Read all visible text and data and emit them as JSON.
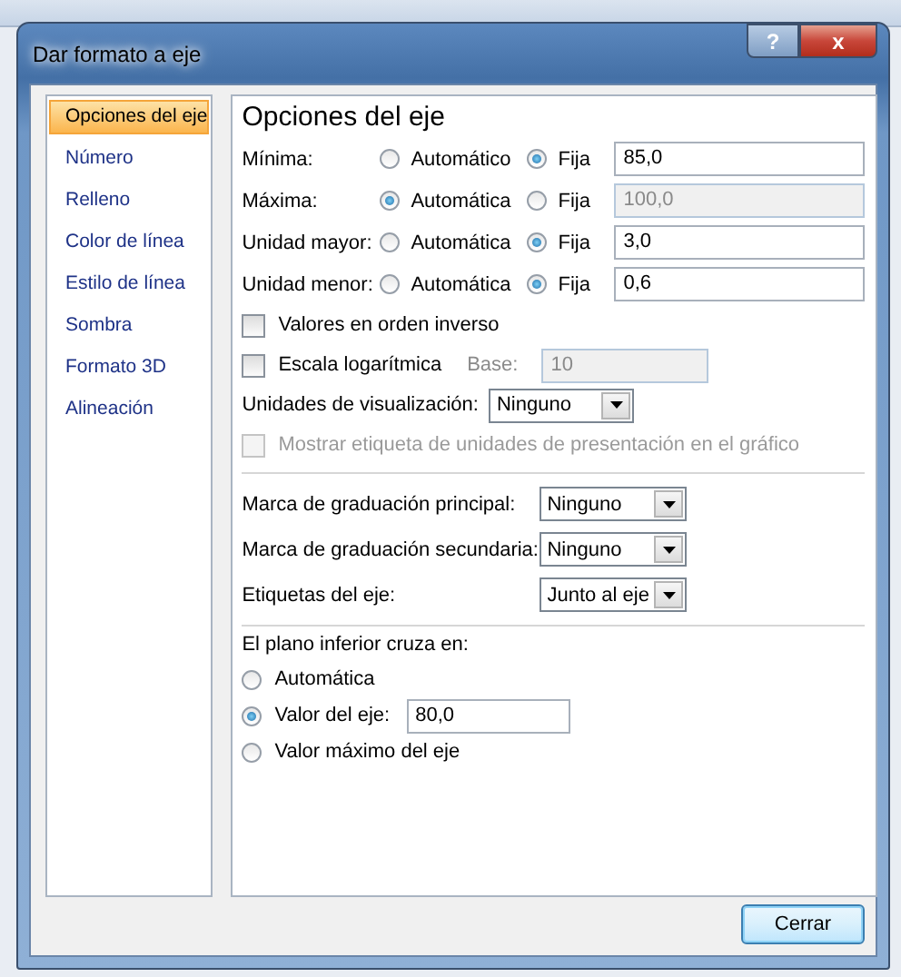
{
  "window": {
    "title": "Dar formato a eje",
    "help_button": "?",
    "close_button": "x"
  },
  "sidebar": {
    "items": [
      {
        "label": "Opciones del eje",
        "selected": true
      },
      {
        "label": "Número",
        "selected": false
      },
      {
        "label": "Relleno",
        "selected": false
      },
      {
        "label": "Color de línea",
        "selected": false
      },
      {
        "label": "Estilo de línea",
        "selected": false
      },
      {
        "label": "Sombra",
        "selected": false
      },
      {
        "label": "Formato 3D",
        "selected": false
      },
      {
        "label": "Alineación",
        "selected": false
      }
    ]
  },
  "panel": {
    "title": "Opciones del eje",
    "bounds": [
      {
        "label": "Mínima:",
        "options": [
          {
            "label": "Automático",
            "selected": false
          },
          {
            "label": "Fija",
            "selected": true
          }
        ],
        "value": "85,0",
        "disabled": false
      },
      {
        "label": "Máxima:",
        "options": [
          {
            "label": "Automática",
            "selected": true
          },
          {
            "label": "Fija",
            "selected": false
          }
        ],
        "value": "100,0",
        "disabled": true
      },
      {
        "label": "Unidad mayor:",
        "options": [
          {
            "label": "Automática",
            "selected": false
          },
          {
            "label": "Fija",
            "selected": true
          }
        ],
        "value": "3,0",
        "disabled": false
      },
      {
        "label": "Unidad menor:",
        "options": [
          {
            "label": "Automática",
            "selected": false
          },
          {
            "label": "Fija",
            "selected": true
          }
        ],
        "value": "0,6",
        "disabled": false
      }
    ],
    "reverse": {
      "label": "Valores en orden inverso",
      "checked": false
    },
    "log_scale": {
      "label": "Escala logarítmica",
      "checked": false,
      "base_label": "Base:",
      "base_value": "10",
      "base_disabled": true
    },
    "display_units": {
      "label": "Unidades de visualización:",
      "value": "Ninguno"
    },
    "show_units_label": {
      "label": "Mostrar etiqueta de unidades de presentación en el gráfico",
      "checked": false,
      "disabled": true
    },
    "ticks": [
      {
        "label": "Marca de graduación principal:",
        "value": "Ninguno"
      },
      {
        "label": "Marca de graduación secundaria:",
        "value": "Ninguno"
      },
      {
        "label": "Etiquetas del eje:",
        "value": "Junto al eje"
      }
    ],
    "crosses": {
      "title": "El plano inferior cruza en:",
      "options": [
        {
          "label": "Automática",
          "selected": false
        },
        {
          "label": "Valor del eje:",
          "selected": true,
          "value": "80,0"
        },
        {
          "label": "Valor máximo del eje",
          "selected": false
        }
      ]
    }
  },
  "buttons": [
    "Cerrar"
  ]
}
